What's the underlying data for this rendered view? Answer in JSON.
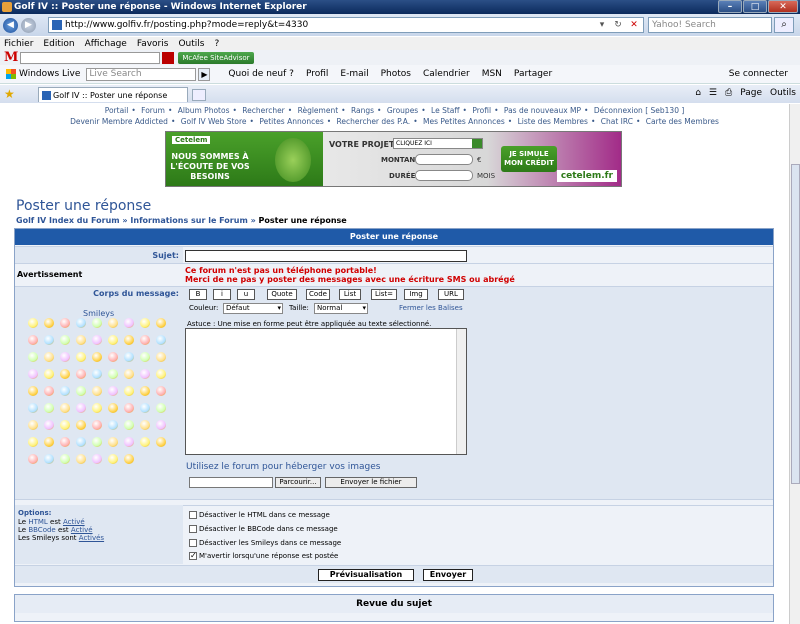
{
  "window": {
    "title": "Golf IV :: Poster une réponse - Windows Internet Explorer",
    "min": "–",
    "max": "□",
    "close": "✕"
  },
  "address": {
    "url": "http://www.golfiv.fr/posting.php?mode=reply&t=4330",
    "search_placeholder": "Yahoo! Search"
  },
  "menu": [
    "Fichier",
    "Edition",
    "Affichage",
    "Favoris",
    "Outils",
    "?"
  ],
  "mcafee": {
    "site_advisor": "McAfee SiteAdvisor"
  },
  "windows_live": {
    "label": "Windows Live",
    "search_placeholder": "Live Search",
    "links": [
      "Quoi de neuf ?",
      "Profil",
      "E-mail",
      "Photos",
      "Calendrier",
      "MSN",
      "Partager"
    ],
    "connect": "Se connecter"
  },
  "tab": {
    "title": "Golf IV :: Poster une réponse",
    "page_menu": "Page",
    "tools_menu": "Outils"
  },
  "toplinks_1": [
    "Portail",
    "Forum",
    "Album Photos",
    "Rechercher",
    "Règlement",
    "Rangs",
    "Groupes",
    "Le Staff",
    "Profil",
    "Pas de nouveaux MP",
    "Déconnexion [ Seb130 ]"
  ],
  "toplinks_2": [
    "Devenir Membre Addicted",
    "Golf IV Web Store",
    "Petites Annonces",
    "Rechercher des P.A.",
    "Mes Petites Annonces",
    "Liste des Membres",
    "Chat IRC",
    "Carte des Membres"
  ],
  "banner": {
    "logo": "Cetelem",
    "message": "NOUS SOMMES À L'ÉCOUTE DE VOS BESOINS",
    "project_label": "VOTRE PROJET :",
    "project_value": "CLIQUEZ ICI",
    "amount_label": "MONTANT :",
    "amount_unit": "€",
    "duration_label": "DURÉE :",
    "duration_unit": "MOIS",
    "cta": "JE SIMULE MON CRÉDIT",
    "brand": "cetelem.fr"
  },
  "page": {
    "title": "Poster une réponse",
    "breadcrumb": {
      "index": "Golf IV Index du Forum",
      "section": "Informations sur le Forum",
      "current": "Poster une réponse",
      "sep": "»"
    }
  },
  "form": {
    "header": "Poster une réponse",
    "subject_label": "Sujet:",
    "warning_label": "Avertissement",
    "warning_1": "Ce forum n'est pas un téléphone portable!",
    "warning_2": "Merci de ne pas y poster des messages avec une écriture SMS ou abrégé",
    "body_label": "Corps du message:",
    "smileys_label": "Smileys",
    "bbcode_buttons": [
      "B",
      "i",
      "u",
      "Quote",
      "Code",
      "List",
      "List=",
      "Img",
      "URL"
    ],
    "color_label": "Couleur:",
    "color_value": "Défaut",
    "size_label": "Taille:",
    "size_value": "Normal",
    "close_tags": "Fermer les Balises",
    "tip": "Astuce : Une mise en forme peut être appliquée au texte sélectionné.",
    "host_images": "Utilisez le forum pour héberger vos images",
    "browse": "Parcourir...",
    "upload": "Envoyer le fichier",
    "options_label": "Options:",
    "opt_html": {
      "a": "Le",
      "b": "HTML",
      "c": "est",
      "d": "Activé"
    },
    "opt_bbcode": {
      "a": "Le",
      "b": "BBCode",
      "c": "est",
      "d": "Activé"
    },
    "opt_smileys": {
      "a": "Les Smileys sont",
      "d": "Activés"
    },
    "checkboxes": [
      {
        "label": "Désactiver le HTML dans ce message",
        "checked": false
      },
      {
        "label": "Désactiver le BBCode dans ce message",
        "checked": false
      },
      {
        "label": "Désactiver les Smileys dans ce message",
        "checked": false
      },
      {
        "label": "M'avertir lorsqu'une réponse est postée",
        "checked": true
      }
    ],
    "preview": "Prévisualisation",
    "send": "Envoyer"
  },
  "review": {
    "title": "Revue du sujet"
  }
}
